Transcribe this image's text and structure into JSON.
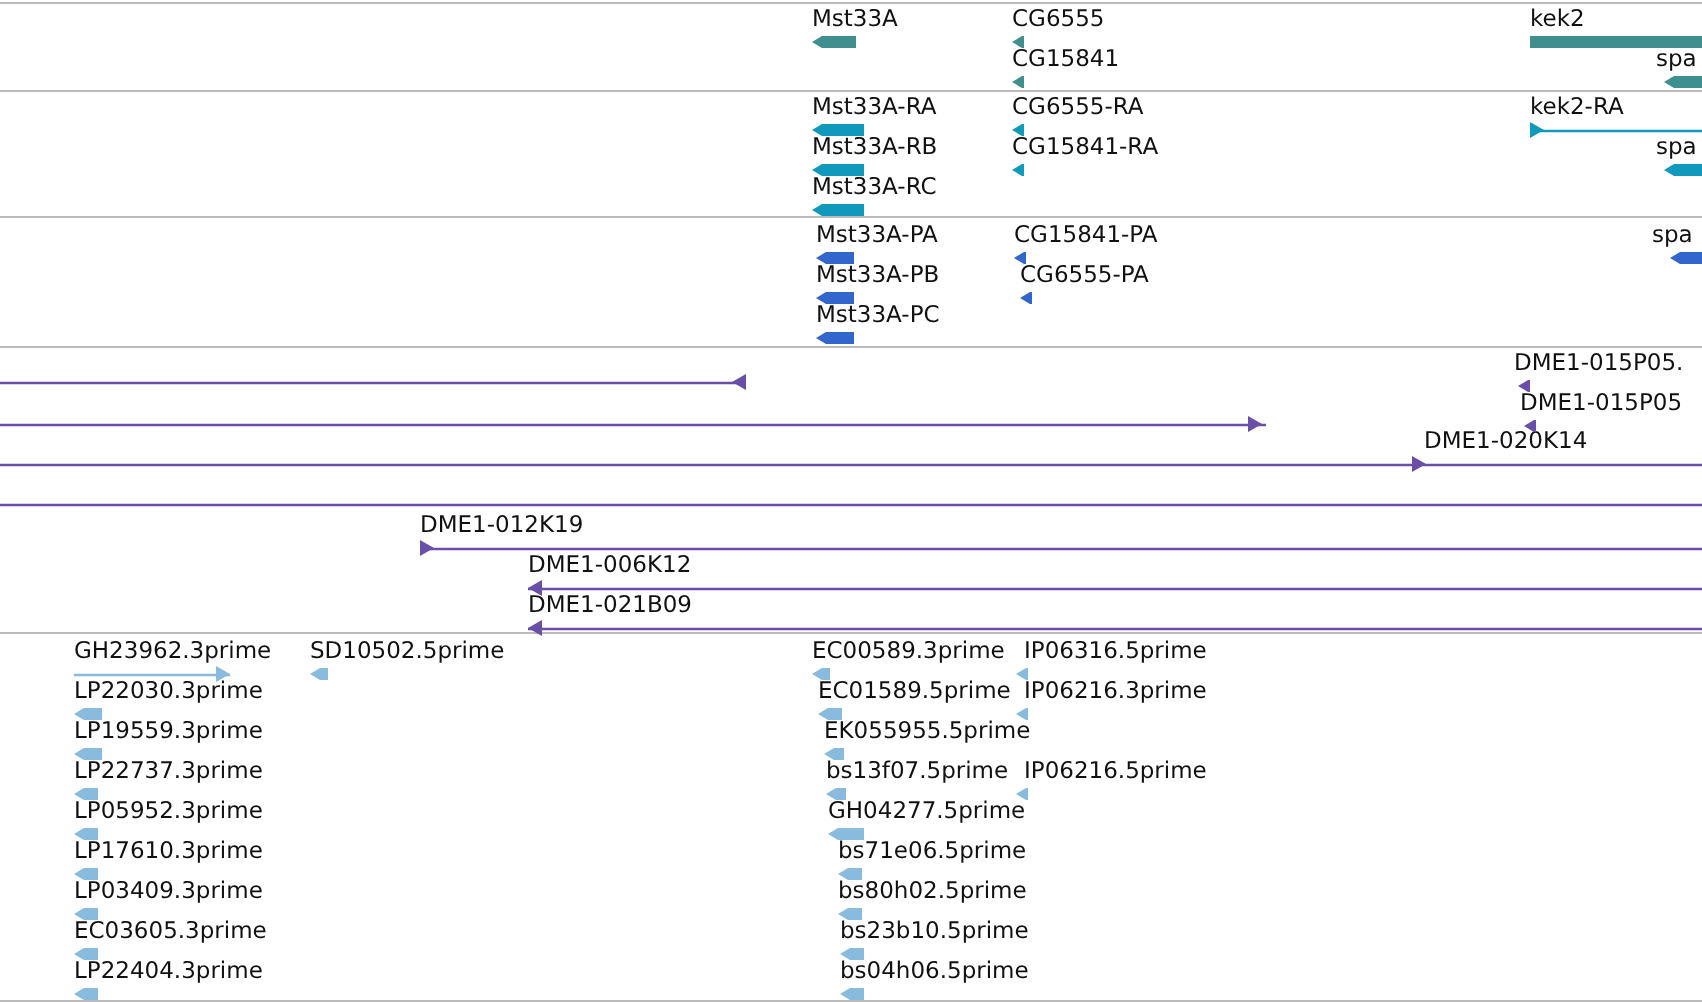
{
  "tracks": [
    {
      "features": [
        {
          "label": "Mst33A",
          "kind": "arrow",
          "reverse": true
        },
        {
          "label": "CG6555",
          "kind": "arrow",
          "reverse": true
        },
        {
          "label": "CG15841",
          "kind": "arrow",
          "reverse": true
        },
        {
          "label": "kek2",
          "kind": "plain"
        },
        {
          "label": "spa",
          "kind": "arrow",
          "reverse": true
        }
      ]
    },
    {
      "features": [
        {
          "label": "Mst33A-RA",
          "kind": "arrow",
          "reverse": true
        },
        {
          "label": "Mst33A-RB",
          "kind": "arrow",
          "reverse": true
        },
        {
          "label": "Mst33A-RC",
          "kind": "arrow",
          "reverse": true
        },
        {
          "label": "CG6555-RA",
          "kind": "arrow",
          "reverse": true
        },
        {
          "label": "CG15841-RA",
          "kind": "arrow",
          "reverse": true
        },
        {
          "label": "kek2-RA",
          "kind": "arrow",
          "reverse": false
        },
        {
          "label": "spa",
          "kind": "arrow",
          "reverse": true
        }
      ]
    },
    {
      "features": [
        {
          "label": "Mst33A-PA",
          "kind": "arrow",
          "reverse": true
        },
        {
          "label": "Mst33A-PB",
          "kind": "arrow",
          "reverse": true
        },
        {
          "label": "Mst33A-PC",
          "kind": "arrow",
          "reverse": true
        },
        {
          "label": "CG15841-PA",
          "kind": "arrow",
          "reverse": true
        },
        {
          "label": "CG6555-PA",
          "kind": "arrow",
          "reverse": true
        },
        {
          "label": "spa",
          "kind": "arrow",
          "reverse": true
        }
      ]
    },
    {
      "features": [
        {
          "kind": "arrow",
          "reverse": true
        },
        {
          "kind": "arrow",
          "reverse": false
        },
        {
          "label": "DME1-020K14",
          "kind": "arrow",
          "reverse": false
        },
        {
          "label": "DME1-015P05.",
          "kind": "arrow",
          "reverse": true
        },
        {
          "label": "DME1-015P05",
          "kind": "arrow",
          "reverse": true
        },
        {
          "kind": "plain"
        },
        {
          "label": "DME1-012K19",
          "kind": "arrow",
          "reverse": false
        },
        {
          "label": "DME1-006K12",
          "kind": "arrow",
          "reverse": true
        },
        {
          "label": "DME1-021B09",
          "kind": "arrow",
          "reverse": true
        }
      ]
    },
    {
      "features": [
        {
          "label": "GH23962.3prime",
          "kind": "arrow",
          "reverse": false
        },
        {
          "label": "LP22030.3prime",
          "kind": "arrow",
          "reverse": true
        },
        {
          "label": "LP19559.3prime",
          "kind": "arrow",
          "reverse": true
        },
        {
          "label": "LP22737.3prime",
          "kind": "arrow",
          "reverse": true
        },
        {
          "label": "LP05952.3prime",
          "kind": "arrow",
          "reverse": true
        },
        {
          "label": "LP17610.3prime",
          "kind": "arrow",
          "reverse": true
        },
        {
          "label": "LP03409.3prime",
          "kind": "arrow",
          "reverse": true
        },
        {
          "label": "EC03605.3prime",
          "kind": "arrow",
          "reverse": true
        },
        {
          "label": "LP22404.3prime",
          "kind": "arrow",
          "reverse": true
        },
        {
          "label": "SD10502.5prime",
          "kind": "arrow",
          "reverse": true
        },
        {
          "label": "EC00589.3prime",
          "kind": "arrow",
          "reverse": true
        },
        {
          "label": "EC01589.5prime",
          "kind": "arrow",
          "reverse": true
        },
        {
          "label": "EK055955.5prime",
          "kind": "arrow",
          "reverse": true
        },
        {
          "label": "bs13f07.5prime",
          "kind": "arrow",
          "reverse": true
        },
        {
          "label": "GH04277.5prime",
          "kind": "arrow",
          "reverse": true
        },
        {
          "label": "bs71e06.5prime",
          "kind": "arrow",
          "reverse": true
        },
        {
          "label": "bs80h02.5prime",
          "kind": "arrow",
          "reverse": true
        },
        {
          "label": "bs23b10.5prime",
          "kind": "arrow",
          "reverse": true
        },
        {
          "label": "bs04h06.5prime",
          "kind": "arrow",
          "reverse": true
        },
        {
          "label": "IP06316.5prime",
          "kind": "arrow",
          "reverse": true
        },
        {
          "label": "IP06216.3prime",
          "kind": "arrow",
          "reverse": true
        },
        {
          "label": "IP06216.5prime",
          "kind": "arrow",
          "reverse": true
        }
      ]
    }
  ]
}
